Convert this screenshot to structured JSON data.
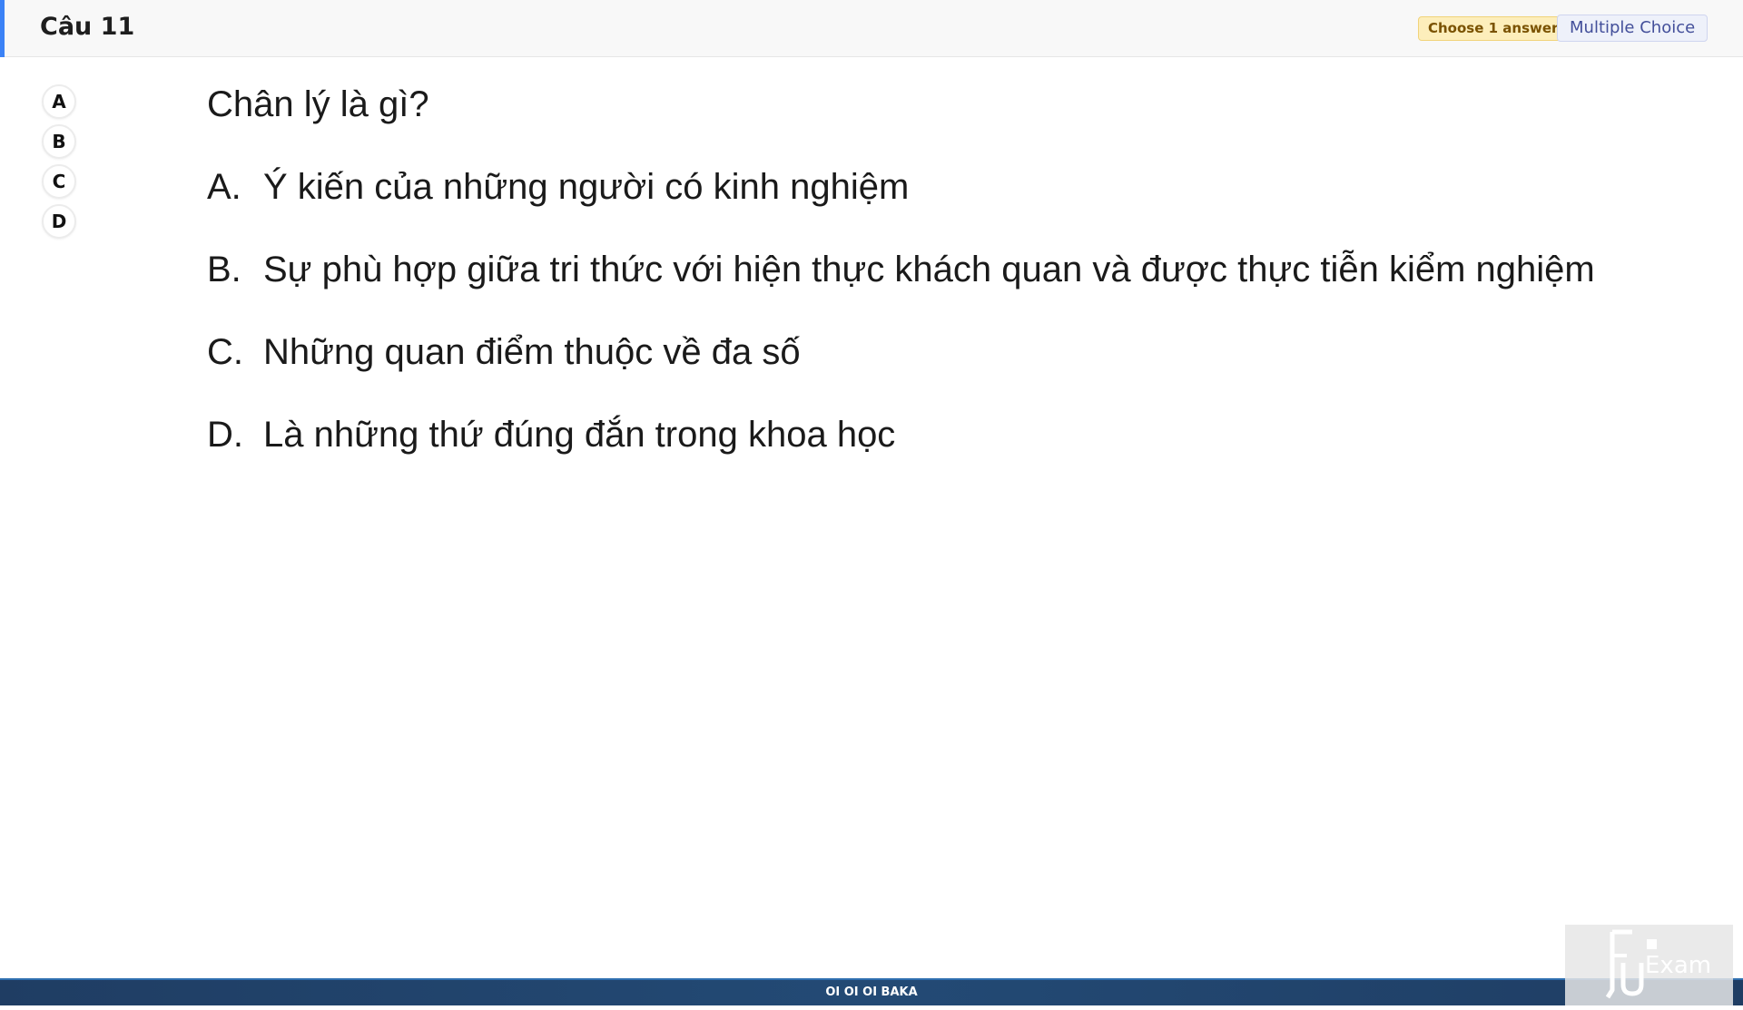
{
  "header": {
    "title": "Câu 11",
    "badge_choose": "Choose 1 answer",
    "badge_type": "Multiple Choice",
    "accent_color": "#3b82f6"
  },
  "options": [
    "A",
    "B",
    "C",
    "D"
  ],
  "question": {
    "text": "Chân lý là gì?",
    "answers": [
      {
        "letter": "A.",
        "text": "Ý kiến của những người có kinh nghiệm"
      },
      {
        "letter": "B.",
        "text": "Sự phù hợp giữa tri thức với hiện thực khách quan và được thực tiễn kiểm nghiệm"
      },
      {
        "letter": "C.",
        "text": "Những quan điểm thuộc về đa số"
      },
      {
        "letter": "D.",
        "text": "Là những thứ đúng đắn trong khoa học"
      }
    ]
  },
  "footer": {
    "text": "OI OI OI BAKA"
  },
  "logo": {
    "icon": "fu-exam-logo",
    "text": "Exam"
  }
}
